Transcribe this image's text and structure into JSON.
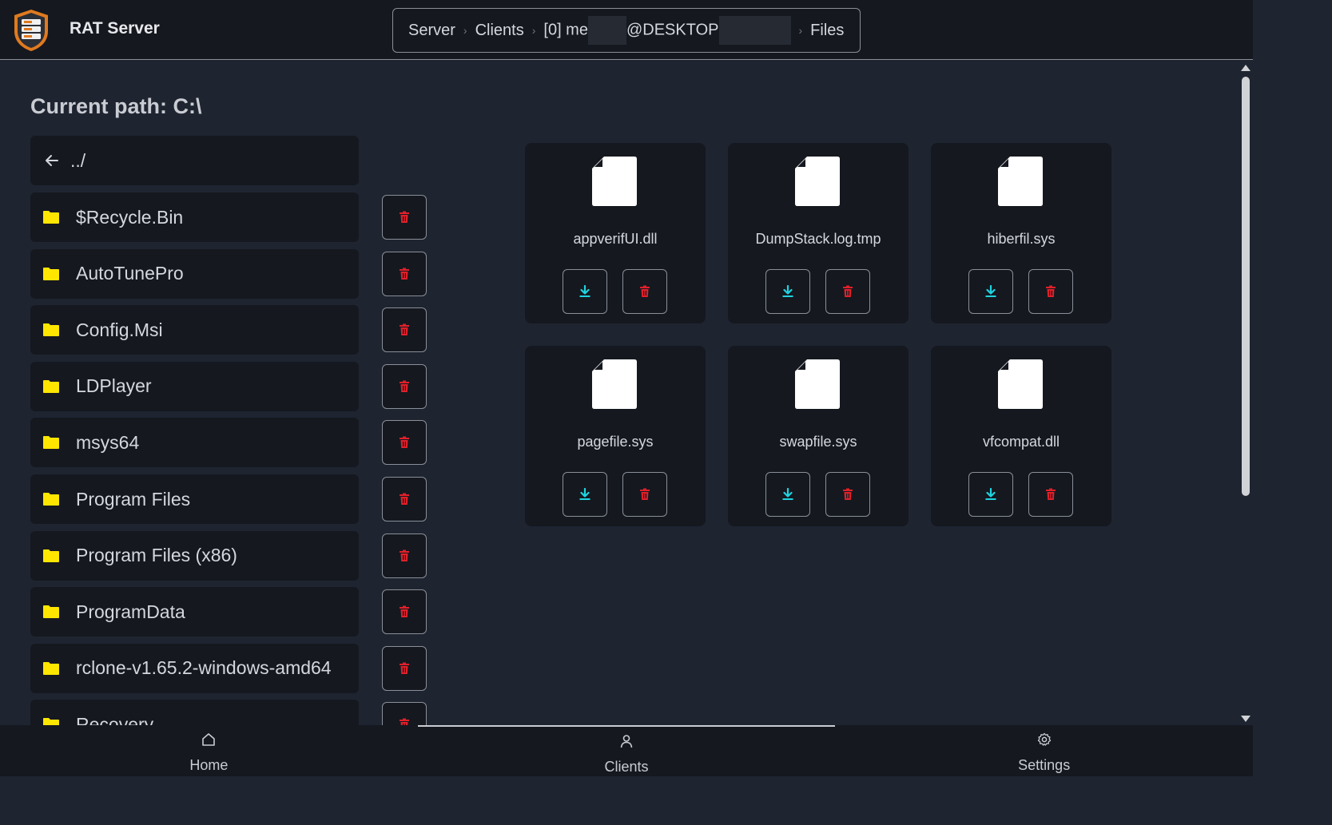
{
  "app": {
    "title": "RAT Server"
  },
  "breadcrumb": {
    "items": [
      "Server",
      "Clients",
      "[0] me",
      "@DESKTOP",
      "Files"
    ]
  },
  "main": {
    "path_label": "Current path: C:\\",
    "up_label": "../",
    "folders": [
      "$Recycle.Bin",
      "AutoTunePro",
      "Config.Msi",
      "LDPlayer",
      "msys64",
      "Program Files",
      "Program Files (x86)",
      "ProgramData",
      "rclone-v1.65.2-windows-amd64",
      "Recovery"
    ],
    "files": [
      "appverifUI.dll",
      "DumpStack.log.tmp",
      "hiberfil.sys",
      "pagefile.sys",
      "swapfile.sys",
      "vfcompat.dll"
    ]
  },
  "nav": {
    "items": [
      {
        "label": "Home",
        "icon": "home-icon"
      },
      {
        "label": "Clients",
        "icon": "user-icon"
      },
      {
        "label": "Settings",
        "icon": "gear-icon"
      }
    ],
    "active": "Clients"
  },
  "colors": {
    "folder": "#ffe600",
    "delete": "#e0202a",
    "download": "#1fd3e0",
    "background": "#1e2430",
    "panel": "#15181f"
  }
}
